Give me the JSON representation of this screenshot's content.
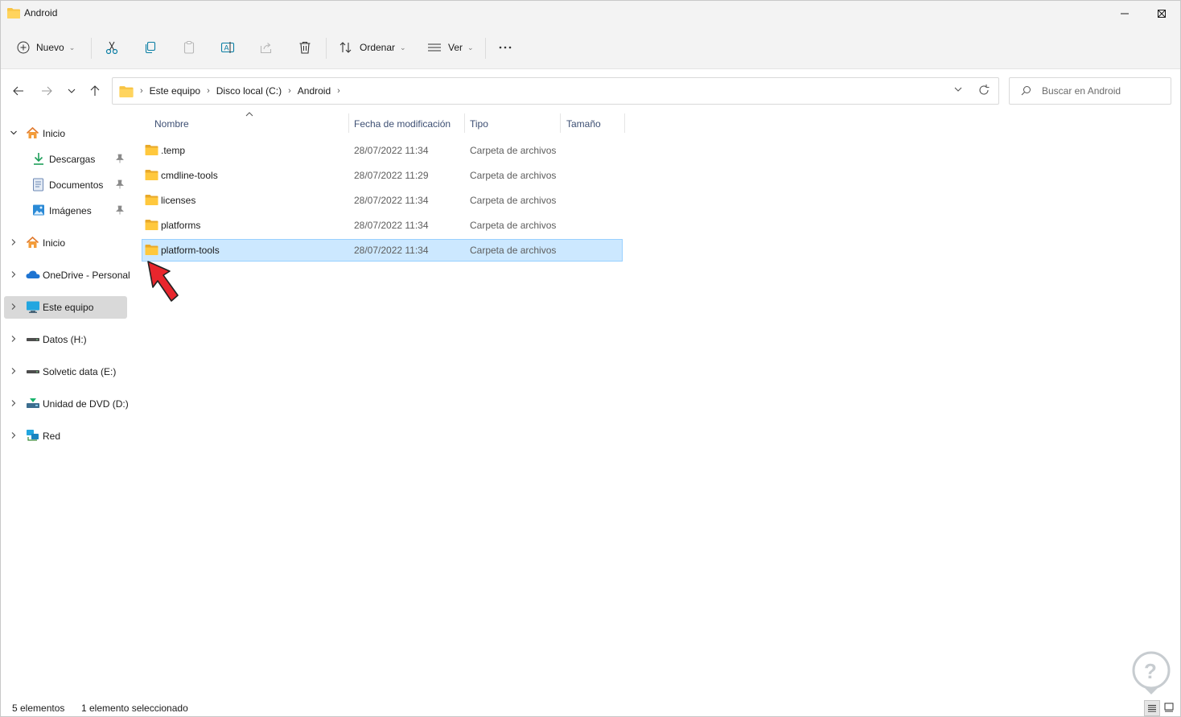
{
  "window": {
    "title": "Android"
  },
  "toolbar": {
    "new_label": "Nuevo",
    "sort_label": "Ordenar",
    "view_label": "Ver",
    "icons": [
      "add-circle-icon",
      "scissors-icon",
      "copy-icon",
      "paste-icon",
      "rename-icon",
      "share-icon",
      "trash-icon",
      "sort-icon",
      "view-icon",
      "more-icon"
    ]
  },
  "address": {
    "crumbs": [
      "Este equipo",
      "Disco local (C:)",
      "Android"
    ],
    "search_placeholder": "Buscar en Android"
  },
  "sidebar": {
    "items": [
      {
        "label": "Inicio",
        "icon": "home-icon",
        "expanded": true
      },
      {
        "label": "Descargas",
        "icon": "download-icon",
        "pinned": true
      },
      {
        "label": "Documentos",
        "icon": "documents-icon",
        "pinned": true
      },
      {
        "label": "Imágenes",
        "icon": "pictures-icon",
        "pinned": true
      },
      {
        "label": "Inicio",
        "icon": "home-icon"
      },
      {
        "label": "OneDrive - Personal",
        "icon": "cloud-icon"
      },
      {
        "label": "Este equipo",
        "icon": "computer-icon",
        "selected": true
      },
      {
        "label": "Datos (H:)",
        "icon": "drive-icon"
      },
      {
        "label": "Solvetic data (E:)",
        "icon": "drive-icon"
      },
      {
        "label": "Unidad de DVD (D:)",
        "icon": "dvd-icon"
      },
      {
        "label": "Red",
        "icon": "network-icon"
      }
    ]
  },
  "columns": {
    "name": "Nombre",
    "date": "Fecha de modificación",
    "type": "Tipo",
    "size": "Tamaño"
  },
  "files": [
    {
      "name": ".temp",
      "date": "28/07/2022 11:34",
      "type": "Carpeta de archivos"
    },
    {
      "name": "cmdline-tools",
      "date": "28/07/2022 11:29",
      "type": "Carpeta de archivos"
    },
    {
      "name": "licenses",
      "date": "28/07/2022 11:34",
      "type": "Carpeta de archivos"
    },
    {
      "name": "platforms",
      "date": "28/07/2022 11:34",
      "type": "Carpeta de archivos"
    },
    {
      "name": "platform-tools",
      "date": "28/07/2022 11:34",
      "type": "Carpeta de archivos",
      "selected": true
    }
  ],
  "status": {
    "count": "5 elementos",
    "selection": "1 elemento seleccionado"
  },
  "colors": {
    "accent": "#0067c0",
    "folder": "#f8c444",
    "selection_bg": "#cce8ff",
    "arrow": "#e8262d"
  }
}
